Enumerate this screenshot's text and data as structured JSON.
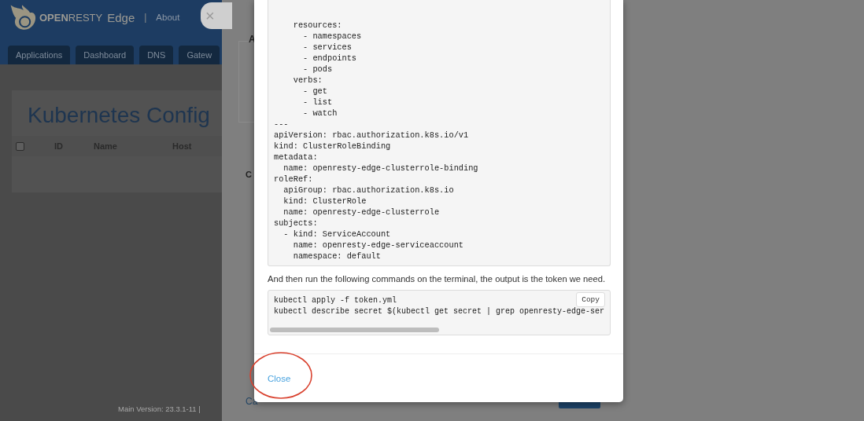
{
  "app": {
    "logo": "**OPEN**RESTY",
    "product": "Edge",
    "separator": "|",
    "nav_link": "About",
    "tabs": [
      {
        "label": "Applications"
      },
      {
        "label": "Dashboard"
      },
      {
        "label": "DNS"
      },
      {
        "label": "Gatew"
      }
    ],
    "heading": "Kubernetes Config",
    "table": {
      "select_all": {
        "checked": false
      },
      "columns": [
        "ID",
        "Name",
        "Host"
      ]
    },
    "footer": "Main Version: 23.3.1-11 |"
  },
  "drawer": {
    "close": "×",
    "labels": [
      {
        "kind": "field",
        "text": "A"
      },
      {
        "kind": "plain",
        "text": "C"
      }
    ],
    "cancel": "Ca"
  },
  "modal": {
    "yaml_lines": [
      "    resources:",
      "      - namespaces",
      "      - services",
      "      - endpoints",
      "      - pods",
      "    verbs:",
      "      - get",
      "      - list",
      "      - watch",
      "---",
      "apiVersion: rbac.authorization.k8s.io/v1",
      "kind: ClusterRoleBinding",
      "metadata:",
      "  name: openresty-edge-clusterrole-binding",
      "roleRef:",
      "  apiGroup: rbac.authorization.k8s.io",
      "  kind: ClusterRole",
      "  name: openresty-edge-clusterrole",
      "subjects:",
      "  - kind: ServiceAccount",
      "    name: openresty-edge-serviceaccount",
      "    namespace: default"
    ],
    "instruction": "And then run the following commands on the terminal, the output is the token we need.",
    "commands": [
      "kubectl apply -f token.yml",
      "kubectl describe secret $(kubectl get secret | grep openresty-edge-ser"
    ],
    "copy": "Copy",
    "close": "Close"
  }
}
